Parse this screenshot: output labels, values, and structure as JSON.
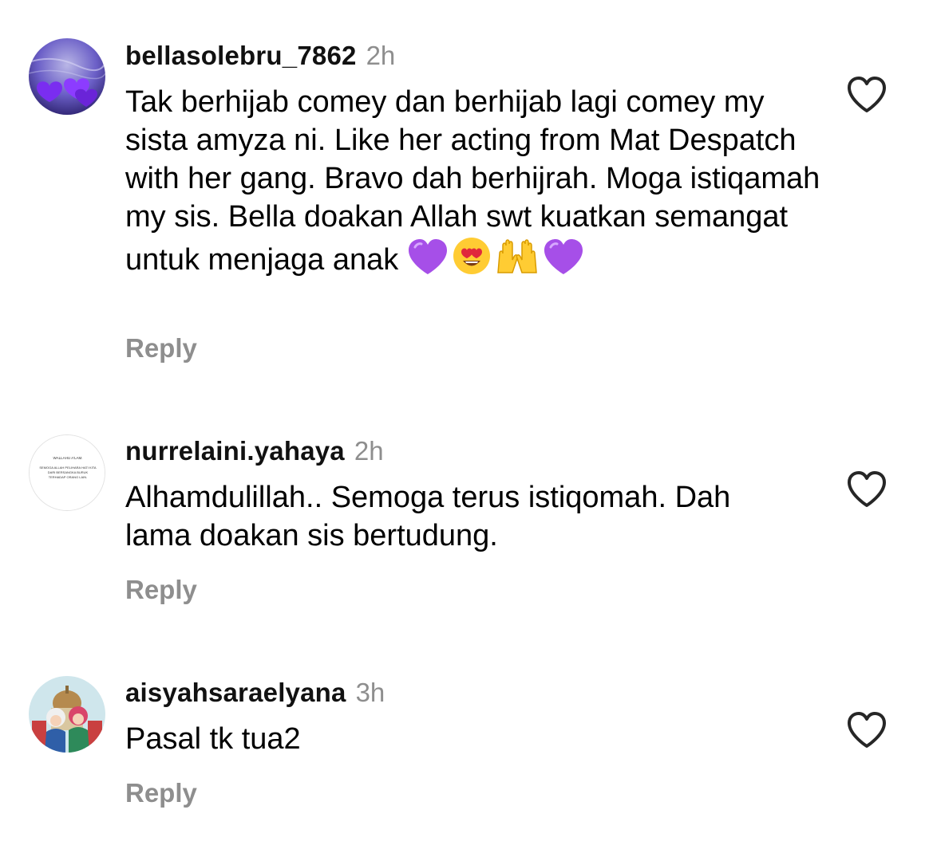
{
  "comments": [
    {
      "username": "bellasolebru_7862",
      "time": "2h",
      "text": "Tak berhijab comey dan berhijab lagi comey my sista amyza ni. Like her acting from Mat Despatch with her gang. Bravo dah berhijrah. Moga istiqamah my sis. Bella doakan Allah swt kuatkan semangat untuk menjaga anak",
      "emojis": [
        "purple-heart",
        "heart-eyes",
        "raising-hands",
        "purple-heart"
      ],
      "reply_label": "Reply",
      "avatar": "purple-hearts-avatar",
      "like_icon": "heart-outline-icon"
    },
    {
      "username": "nurrelaini.yahaya",
      "time": "2h",
      "text": "Alhamdulillah.. Semoga terus istiqomah. Dah lama doakan sis bertudung.",
      "reply_label": "Reply",
      "avatar": "text-avatar",
      "avatar_text_1": "WALLAHU A'LAM.",
      "avatar_text_2": "SEMOGA ALLAH PELIHARA HATI KITA DARI BERSANGKA BURUK TERHADAP ORANG LAIN.",
      "like_icon": "heart-outline-icon"
    },
    {
      "username": "aisyahsaraelyana",
      "time": "3h",
      "text": "Pasal tk tua2",
      "reply_label": "Reply",
      "avatar": "illustrated-girls-avatar",
      "like_icon": "heart-outline-icon"
    }
  ],
  "colors": {
    "text": "#000000",
    "secondary": "#8e8e8e",
    "purple_heart": "#a64fe8",
    "emoji_yellow": "#ffcc33"
  }
}
